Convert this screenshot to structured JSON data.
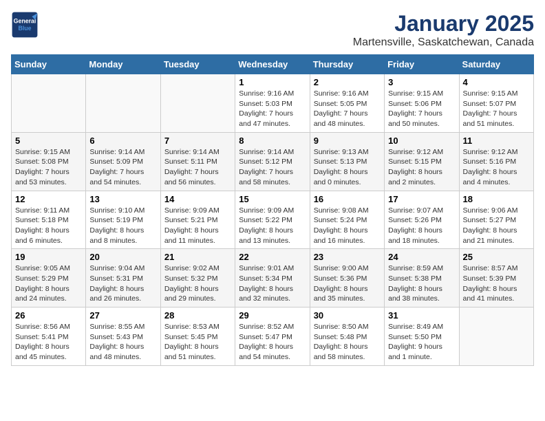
{
  "header": {
    "logo_line1": "General",
    "logo_line2": "Blue",
    "title": "January 2025",
    "subtitle": "Martensville, Saskatchewan, Canada"
  },
  "weekdays": [
    "Sunday",
    "Monday",
    "Tuesday",
    "Wednesday",
    "Thursday",
    "Friday",
    "Saturday"
  ],
  "weeks": [
    [
      {
        "day": "",
        "info": ""
      },
      {
        "day": "",
        "info": ""
      },
      {
        "day": "",
        "info": ""
      },
      {
        "day": "1",
        "info": "Sunrise: 9:16 AM\nSunset: 5:03 PM\nDaylight: 7 hours\nand 47 minutes."
      },
      {
        "day": "2",
        "info": "Sunrise: 9:16 AM\nSunset: 5:05 PM\nDaylight: 7 hours\nand 48 minutes."
      },
      {
        "day": "3",
        "info": "Sunrise: 9:15 AM\nSunset: 5:06 PM\nDaylight: 7 hours\nand 50 minutes."
      },
      {
        "day": "4",
        "info": "Sunrise: 9:15 AM\nSunset: 5:07 PM\nDaylight: 7 hours\nand 51 minutes."
      }
    ],
    [
      {
        "day": "5",
        "info": "Sunrise: 9:15 AM\nSunset: 5:08 PM\nDaylight: 7 hours\nand 53 minutes."
      },
      {
        "day": "6",
        "info": "Sunrise: 9:14 AM\nSunset: 5:09 PM\nDaylight: 7 hours\nand 54 minutes."
      },
      {
        "day": "7",
        "info": "Sunrise: 9:14 AM\nSunset: 5:11 PM\nDaylight: 7 hours\nand 56 minutes."
      },
      {
        "day": "8",
        "info": "Sunrise: 9:14 AM\nSunset: 5:12 PM\nDaylight: 7 hours\nand 58 minutes."
      },
      {
        "day": "9",
        "info": "Sunrise: 9:13 AM\nSunset: 5:13 PM\nDaylight: 8 hours\nand 0 minutes."
      },
      {
        "day": "10",
        "info": "Sunrise: 9:12 AM\nSunset: 5:15 PM\nDaylight: 8 hours\nand 2 minutes."
      },
      {
        "day": "11",
        "info": "Sunrise: 9:12 AM\nSunset: 5:16 PM\nDaylight: 8 hours\nand 4 minutes."
      }
    ],
    [
      {
        "day": "12",
        "info": "Sunrise: 9:11 AM\nSunset: 5:18 PM\nDaylight: 8 hours\nand 6 minutes."
      },
      {
        "day": "13",
        "info": "Sunrise: 9:10 AM\nSunset: 5:19 PM\nDaylight: 8 hours\nand 8 minutes."
      },
      {
        "day": "14",
        "info": "Sunrise: 9:09 AM\nSunset: 5:21 PM\nDaylight: 8 hours\nand 11 minutes."
      },
      {
        "day": "15",
        "info": "Sunrise: 9:09 AM\nSunset: 5:22 PM\nDaylight: 8 hours\nand 13 minutes."
      },
      {
        "day": "16",
        "info": "Sunrise: 9:08 AM\nSunset: 5:24 PM\nDaylight: 8 hours\nand 16 minutes."
      },
      {
        "day": "17",
        "info": "Sunrise: 9:07 AM\nSunset: 5:26 PM\nDaylight: 8 hours\nand 18 minutes."
      },
      {
        "day": "18",
        "info": "Sunrise: 9:06 AM\nSunset: 5:27 PM\nDaylight: 8 hours\nand 21 minutes."
      }
    ],
    [
      {
        "day": "19",
        "info": "Sunrise: 9:05 AM\nSunset: 5:29 PM\nDaylight: 8 hours\nand 24 minutes."
      },
      {
        "day": "20",
        "info": "Sunrise: 9:04 AM\nSunset: 5:31 PM\nDaylight: 8 hours\nand 26 minutes."
      },
      {
        "day": "21",
        "info": "Sunrise: 9:02 AM\nSunset: 5:32 PM\nDaylight: 8 hours\nand 29 minutes."
      },
      {
        "day": "22",
        "info": "Sunrise: 9:01 AM\nSunset: 5:34 PM\nDaylight: 8 hours\nand 32 minutes."
      },
      {
        "day": "23",
        "info": "Sunrise: 9:00 AM\nSunset: 5:36 PM\nDaylight: 8 hours\nand 35 minutes."
      },
      {
        "day": "24",
        "info": "Sunrise: 8:59 AM\nSunset: 5:38 PM\nDaylight: 8 hours\nand 38 minutes."
      },
      {
        "day": "25",
        "info": "Sunrise: 8:57 AM\nSunset: 5:39 PM\nDaylight: 8 hours\nand 41 minutes."
      }
    ],
    [
      {
        "day": "26",
        "info": "Sunrise: 8:56 AM\nSunset: 5:41 PM\nDaylight: 8 hours\nand 45 minutes."
      },
      {
        "day": "27",
        "info": "Sunrise: 8:55 AM\nSunset: 5:43 PM\nDaylight: 8 hours\nand 48 minutes."
      },
      {
        "day": "28",
        "info": "Sunrise: 8:53 AM\nSunset: 5:45 PM\nDaylight: 8 hours\nand 51 minutes."
      },
      {
        "day": "29",
        "info": "Sunrise: 8:52 AM\nSunset: 5:47 PM\nDaylight: 8 hours\nand 54 minutes."
      },
      {
        "day": "30",
        "info": "Sunrise: 8:50 AM\nSunset: 5:48 PM\nDaylight: 8 hours\nand 58 minutes."
      },
      {
        "day": "31",
        "info": "Sunrise: 8:49 AM\nSunset: 5:50 PM\nDaylight: 9 hours\nand 1 minute."
      },
      {
        "day": "",
        "info": ""
      }
    ]
  ]
}
